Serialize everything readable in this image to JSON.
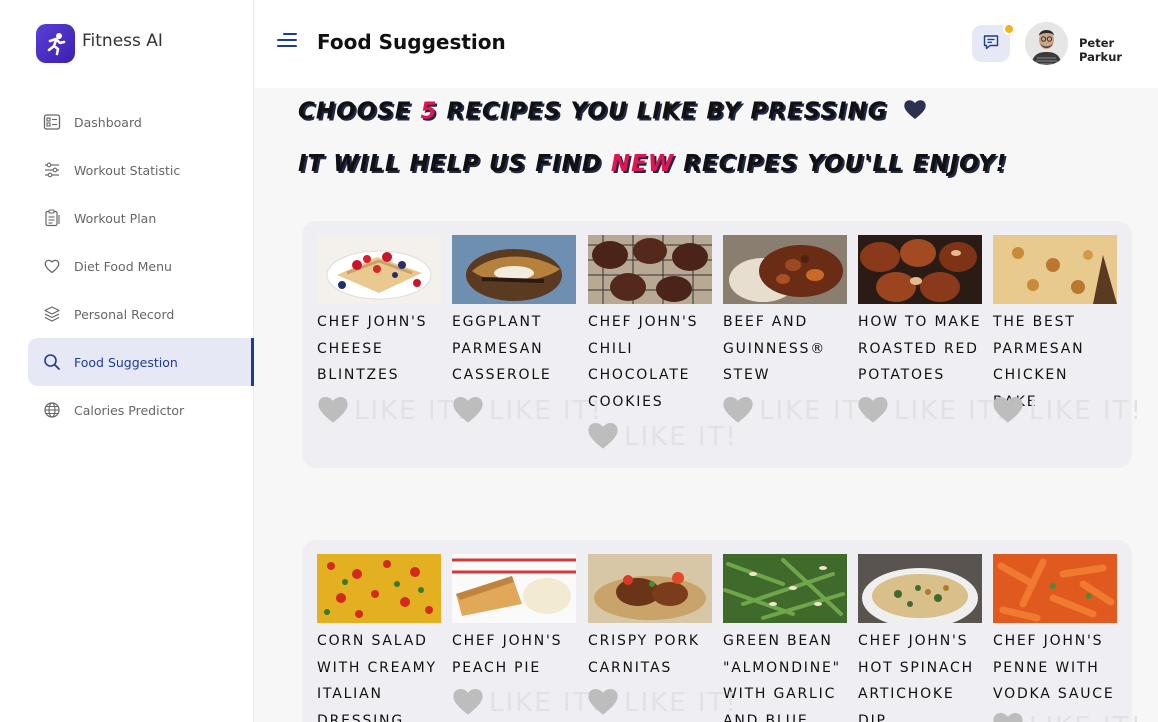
{
  "app": {
    "name": "Fitness AI"
  },
  "sidebar": {
    "items": [
      {
        "label": "Dashboard",
        "icon": "dashboard-icon"
      },
      {
        "label": "Workout Statistic",
        "icon": "sliders-icon"
      },
      {
        "label": "Workout Plan",
        "icon": "clipboard-icon"
      },
      {
        "label": "Diet Food Menu",
        "icon": "heart-icon"
      },
      {
        "label": "Personal Record",
        "icon": "layers-icon"
      },
      {
        "label": "Food Suggestion",
        "icon": "search-icon",
        "active": true
      },
      {
        "label": "Calories Predictor",
        "icon": "globe-icon"
      }
    ]
  },
  "header": {
    "title": "Food Suggestion",
    "user_name": "Peter Parkur",
    "notification_color": "#f5b21c"
  },
  "headline": {
    "line1_a": "CHOOSE ",
    "line1_num": "5",
    "line1_b": " RECIPES YOU LIKE BY PRESSING",
    "line2_a": "IT WILL HELP US FIND ",
    "line2_new": "NEW",
    "line2_b": " RECIPES YOU'LL ENJOY!"
  },
  "like_label": "LIKE IT!",
  "recipes_row1": [
    {
      "name": "CHEF JOHN'S CHEESE BLINTZES"
    },
    {
      "name": "EGGPLANT PARMESAN CASSEROLE"
    },
    {
      "name": "CHEF JOHN'S CHILI CHOCOLATE COOKIES"
    },
    {
      "name": "BEEF AND GUINNESS® STEW"
    },
    {
      "name": "HOW TO MAKE ROASTED RED POTATOES"
    },
    {
      "name": "THE BEST PARMESAN CHICKEN BAKE"
    }
  ],
  "recipes_row2": [
    {
      "name": "CORN SALAD WITH CREAMY ITALIAN DRESSING"
    },
    {
      "name": "CHEF JOHN'S PEACH PIE"
    },
    {
      "name": "CRISPY PORK CARNITAS"
    },
    {
      "name": "GREEN BEAN \"ALMONDINE\" WITH GARLIC AND BLUE"
    },
    {
      "name": "CHEF JOHN'S HOT SPINACH ARTICHOKE DIP"
    },
    {
      "name": "CHEF JOHN'S PENNE WITH VODKA SAUCE"
    }
  ],
  "colors": {
    "accent": "#1f3d8f",
    "highlight": "#e0164f",
    "heart": "#bdbdbd"
  }
}
